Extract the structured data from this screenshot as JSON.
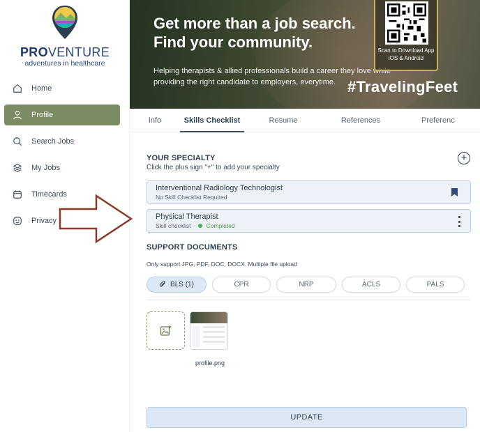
{
  "brand": {
    "name_bold": "PRO",
    "name_rest": "VENTURE",
    "tagline": "adventures in healthcare"
  },
  "sidebar": {
    "items": [
      {
        "label": "Home",
        "icon": "home-icon",
        "active": false
      },
      {
        "label": "Profile",
        "icon": "user-icon",
        "active": true
      },
      {
        "label": "Search Jobs",
        "icon": "search-icon",
        "active": false
      },
      {
        "label": "My Jobs",
        "icon": "layers-icon",
        "active": false
      },
      {
        "label": "Timecards",
        "icon": "calendar-icon",
        "active": false
      },
      {
        "label": "Privacy Policy",
        "icon": "privacy-icon",
        "active": false
      }
    ]
  },
  "hero": {
    "headline": "Get more than a job search. Find your community.",
    "subtext": "Helping therapists & allied professionals build a career they love while providing the right candidate to employers, everytime.",
    "hashtag": "#TravelingFeet",
    "qr_caption": "Scan to Download App iOS & Android"
  },
  "tabs": [
    {
      "label": "Info",
      "active": false
    },
    {
      "label": "Skills Checklist",
      "active": true
    },
    {
      "label": "Resume",
      "active": false
    },
    {
      "label": "References",
      "active": false
    },
    {
      "label": "Preferenc",
      "active": false
    }
  ],
  "specialty": {
    "title": "YOUR SPECIALTY",
    "subtitle": "Click the plus sign \"+\" to add your specialty",
    "add_label": "+",
    "cards": [
      {
        "name": "Interventional Radiology Technologist",
        "meta": "No Skill Checklist Required"
      },
      {
        "name": "Physical Therapist",
        "meta": "Skill checklist",
        "status": "Completed"
      }
    ]
  },
  "documents": {
    "title": "SUPPORT DOCUMENTS",
    "subtitle": "Only support JPG, PDF, DOC, DOCX. Multiple file upload",
    "chips": [
      {
        "label": "BLS (1)",
        "active": true
      },
      {
        "label": "CPR",
        "active": false
      },
      {
        "label": "NRP",
        "active": false
      },
      {
        "label": "ACLS",
        "active": false
      },
      {
        "label": "PALS",
        "active": false
      }
    ],
    "file_name": "profile.png"
  },
  "actions": {
    "update_label": "UPDATE"
  },
  "colors": {
    "accent_green": "#7b8c62",
    "card_bg": "#edf2f9",
    "card_border": "#b9cde8",
    "arrow": "#8b3a2a",
    "status_green": "#4caf50"
  }
}
